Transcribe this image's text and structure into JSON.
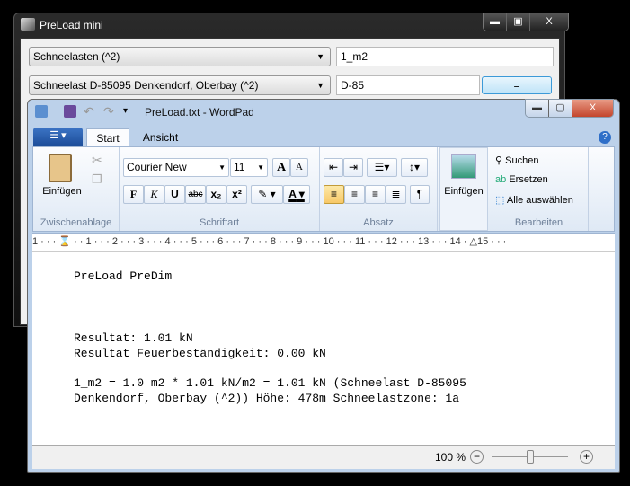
{
  "mini": {
    "title": "PreLoad mini",
    "minimize": "▬",
    "maximize": "▣",
    "close": "X",
    "combo1": "Schneelasten (^2)",
    "input1": "1_m2",
    "combo2": "Schneelast D-85095 Denkendorf, Oberbay (^2)",
    "input2": "D-85",
    "equals": "="
  },
  "wordpad": {
    "title": "PreLoad.txt - WordPad",
    "minimize": "▬",
    "maximize": "▢",
    "close": "X",
    "tabs": [
      "Start",
      "Ansicht"
    ],
    "help": "?",
    "clipboard": {
      "paste": "Einfügen",
      "label": "Zwischenablage"
    },
    "font": {
      "name": "Courier New",
      "size": "11",
      "bold": "F",
      "italic": "K",
      "underline": "U",
      "strike": "abc",
      "sub": "x₂",
      "sup": "x²",
      "label": "Schriftart",
      "grow": "A",
      "shrink": "A",
      "color": "A"
    },
    "paragraph": {
      "label": "Absatz"
    },
    "insert": {
      "label": "Einfügen"
    },
    "edit": {
      "find": "Suchen",
      "replace": "Ersetzen",
      "select_all": "Alle auswählen",
      "label": "Bearbeiten"
    },
    "ruler": "1 · · · ⌛ · · 1 · · · 2 · · · 3 · · · 4 · · · 5 · · · 6 · · · 7 · · · 8 · · · 9 · · · 10 · · · 11 · · · 12 · · · 13 · · · 14 · △15 · · ·",
    "document": [
      "PreLoad PreDim",
      "Resultat: 1.01 kN",
      "Resultat Feuerbeständigkeit: 0.00 kN",
      "1_m2 = 1.0 m2 * 1.01 kN/m2 = 1.01 kN (Schneelast D-85095",
      "Denkendorf, Oberbay (^2)) Höhe: 478m Schneelastzone: 1a"
    ],
    "zoom": {
      "level": "100 %",
      "minus": "−",
      "plus": "+",
      "value_percent": 100
    }
  }
}
